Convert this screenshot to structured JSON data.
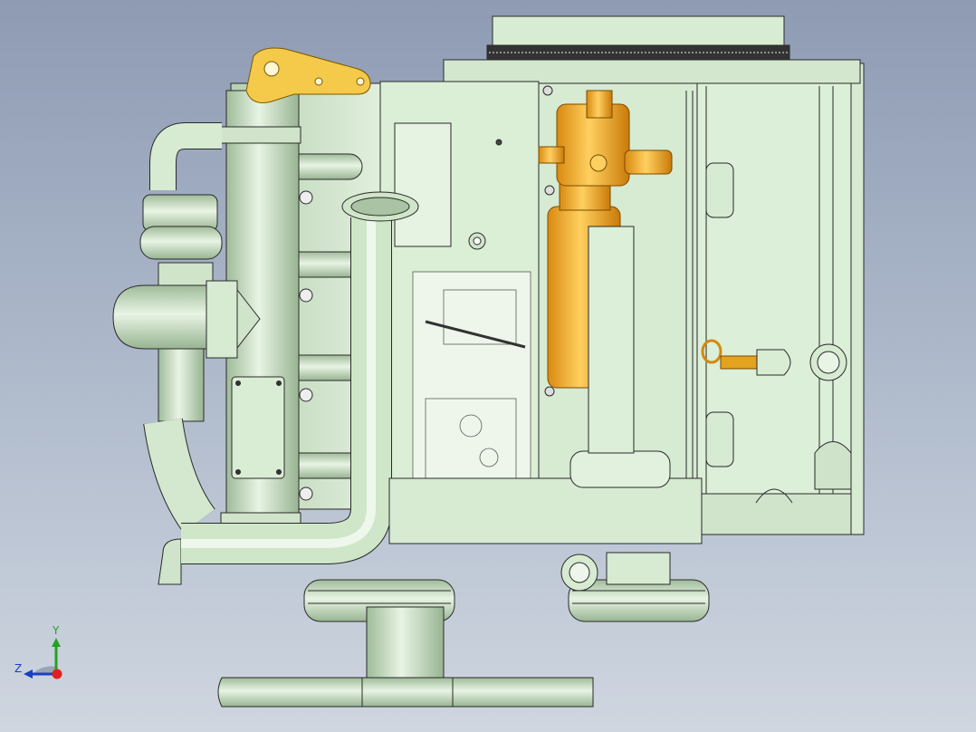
{
  "viewport": {
    "background_top": "#8e9bb3",
    "background_bottom": "#cfd6e0"
  },
  "model": {
    "body_color": "#cfe6c8",
    "body_shadow": "#a9c3a4",
    "outline_color": "#2a2a2a",
    "highlight_color": "#f2a920",
    "highlight_shade": "#d4860d",
    "bracket_color": "#f5c94a"
  },
  "triad": {
    "y_label": "Y",
    "z_label": "Z",
    "x_color": "#e02020",
    "y_color": "#22a322",
    "z_color": "#1b3fbf"
  }
}
